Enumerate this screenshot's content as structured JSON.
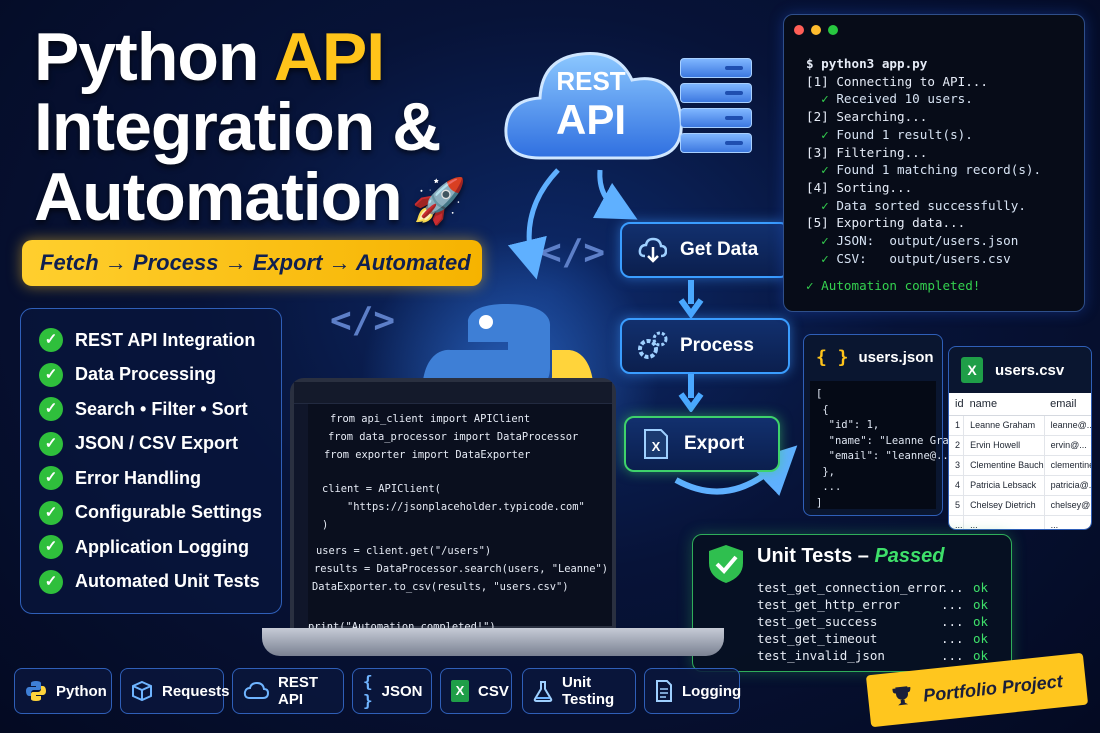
{
  "title": {
    "line1_part1": "Python ",
    "line1_accent": "API",
    "line2": "Integration &",
    "line3": "Automation",
    "rocket": "🚀"
  },
  "tagline": "Fetch → Process → Export → Automated",
  "features": [
    "REST API Integration",
    "Data Processing",
    "Search • Filter • Sort",
    "JSON / CSV Export",
    "Error Handling",
    "Configurable Settings",
    "Application Logging",
    "Automated Unit Tests"
  ],
  "cloud": {
    "line1": "REST",
    "line2": "API"
  },
  "code_symbol": "</>",
  "pipeline": {
    "get_data": "Get Data",
    "process": "Process",
    "export": "Export"
  },
  "terminal": {
    "command": "$ python3 app.py",
    "lines": [
      {
        "text": "[1] Connecting to API...",
        "type": "step"
      },
      {
        "text": "Received 10 users.",
        "type": "ok"
      },
      {
        "text": "[2] Searching...",
        "type": "step"
      },
      {
        "text": "Found 1 result(s).",
        "type": "ok"
      },
      {
        "text": "[3] Filtering...",
        "type": "step"
      },
      {
        "text": "Found 1 matching record(s).",
        "type": "ok"
      },
      {
        "text": "[4] Sorting...",
        "type": "step"
      },
      {
        "text": "Data sorted successfully.",
        "type": "ok"
      },
      {
        "text": "[5] Exporting data...",
        "type": "step"
      },
      {
        "text": "JSON:  output/users.json",
        "type": "ok"
      },
      {
        "text": "CSV:   output/users.csv",
        "type": "ok"
      }
    ],
    "final": "✓ Automation completed!"
  },
  "json_card": {
    "brace": "{ }",
    "title": "users.json",
    "lines": [
      "[",
      " {",
      "  \"id\": 1,",
      "  \"name\": \"Leanne Graham\",",
      "  \"email\": \"leanne@...\"",
      " },",
      " ...",
      "]"
    ]
  },
  "csv_card": {
    "title": "users.csv",
    "icon_letter": "X",
    "headers": [
      "id",
      "name",
      "email"
    ],
    "rows": [
      [
        "1",
        "Leanne Graham",
        "leanne@..."
      ],
      [
        "2",
        "Ervin Howell",
        "ervin@..."
      ],
      [
        "3",
        "Clementine Bauch",
        "clementine@..."
      ],
      [
        "4",
        "Patricia Lebsack",
        "patricia@..."
      ],
      [
        "5",
        "Chelsey Dietrich",
        "chelsey@..."
      ],
      [
        "...",
        "...",
        "..."
      ]
    ]
  },
  "unit_tests": {
    "title": "Unit Tests –",
    "status": "Passed",
    "tests": [
      {
        "name": "test_get_connection_error",
        "dots": "...",
        "result": "ok"
      },
      {
        "name": "test_get_http_error",
        "dots": "...",
        "result": "ok"
      },
      {
        "name": "test_get_success",
        "dots": "...",
        "result": "ok"
      },
      {
        "name": "test_get_timeout",
        "dots": "...",
        "result": "ok"
      },
      {
        "name": "test_invalid_json",
        "dots": "...",
        "result": "ok"
      }
    ]
  },
  "laptop_code": {
    "lines": [
      "from api_client import APIClient",
      "from data_processor import DataProcessor",
      "from exporter import DataExporter",
      "",
      "client = APIClient(",
      "    \"https://jsonplaceholder.typicode.com\"",
      ")",
      "users = client.get(\"/users\")",
      "results = DataProcessor.search(users, \"Leanne\")",
      "DataExporter.to_csv(results, \"users.csv\")",
      "",
      "print(\"Automation completed!\")"
    ]
  },
  "chips": [
    {
      "label": "Python",
      "icon": "python-icon"
    },
    {
      "label": "Requests",
      "icon": "box-icon"
    },
    {
      "label": "REST API",
      "icon": "cloud-icon"
    },
    {
      "label": "JSON",
      "icon": "braces-icon",
      "glyph": "{ }"
    },
    {
      "label": "CSV",
      "icon": "spreadsheet-icon",
      "glyph": "X"
    },
    {
      "label": "Unit Testing",
      "icon": "flask-icon"
    },
    {
      "label": "Logging",
      "icon": "document-icon"
    }
  ],
  "portfolio": {
    "label": "Portfolio Project",
    "icon": "trophy-icon"
  },
  "colors": {
    "accent_yellow": "#ffc41a",
    "success_green": "#34d14f",
    "blue_glow": "#3a9dff",
    "background": "#071338"
  }
}
